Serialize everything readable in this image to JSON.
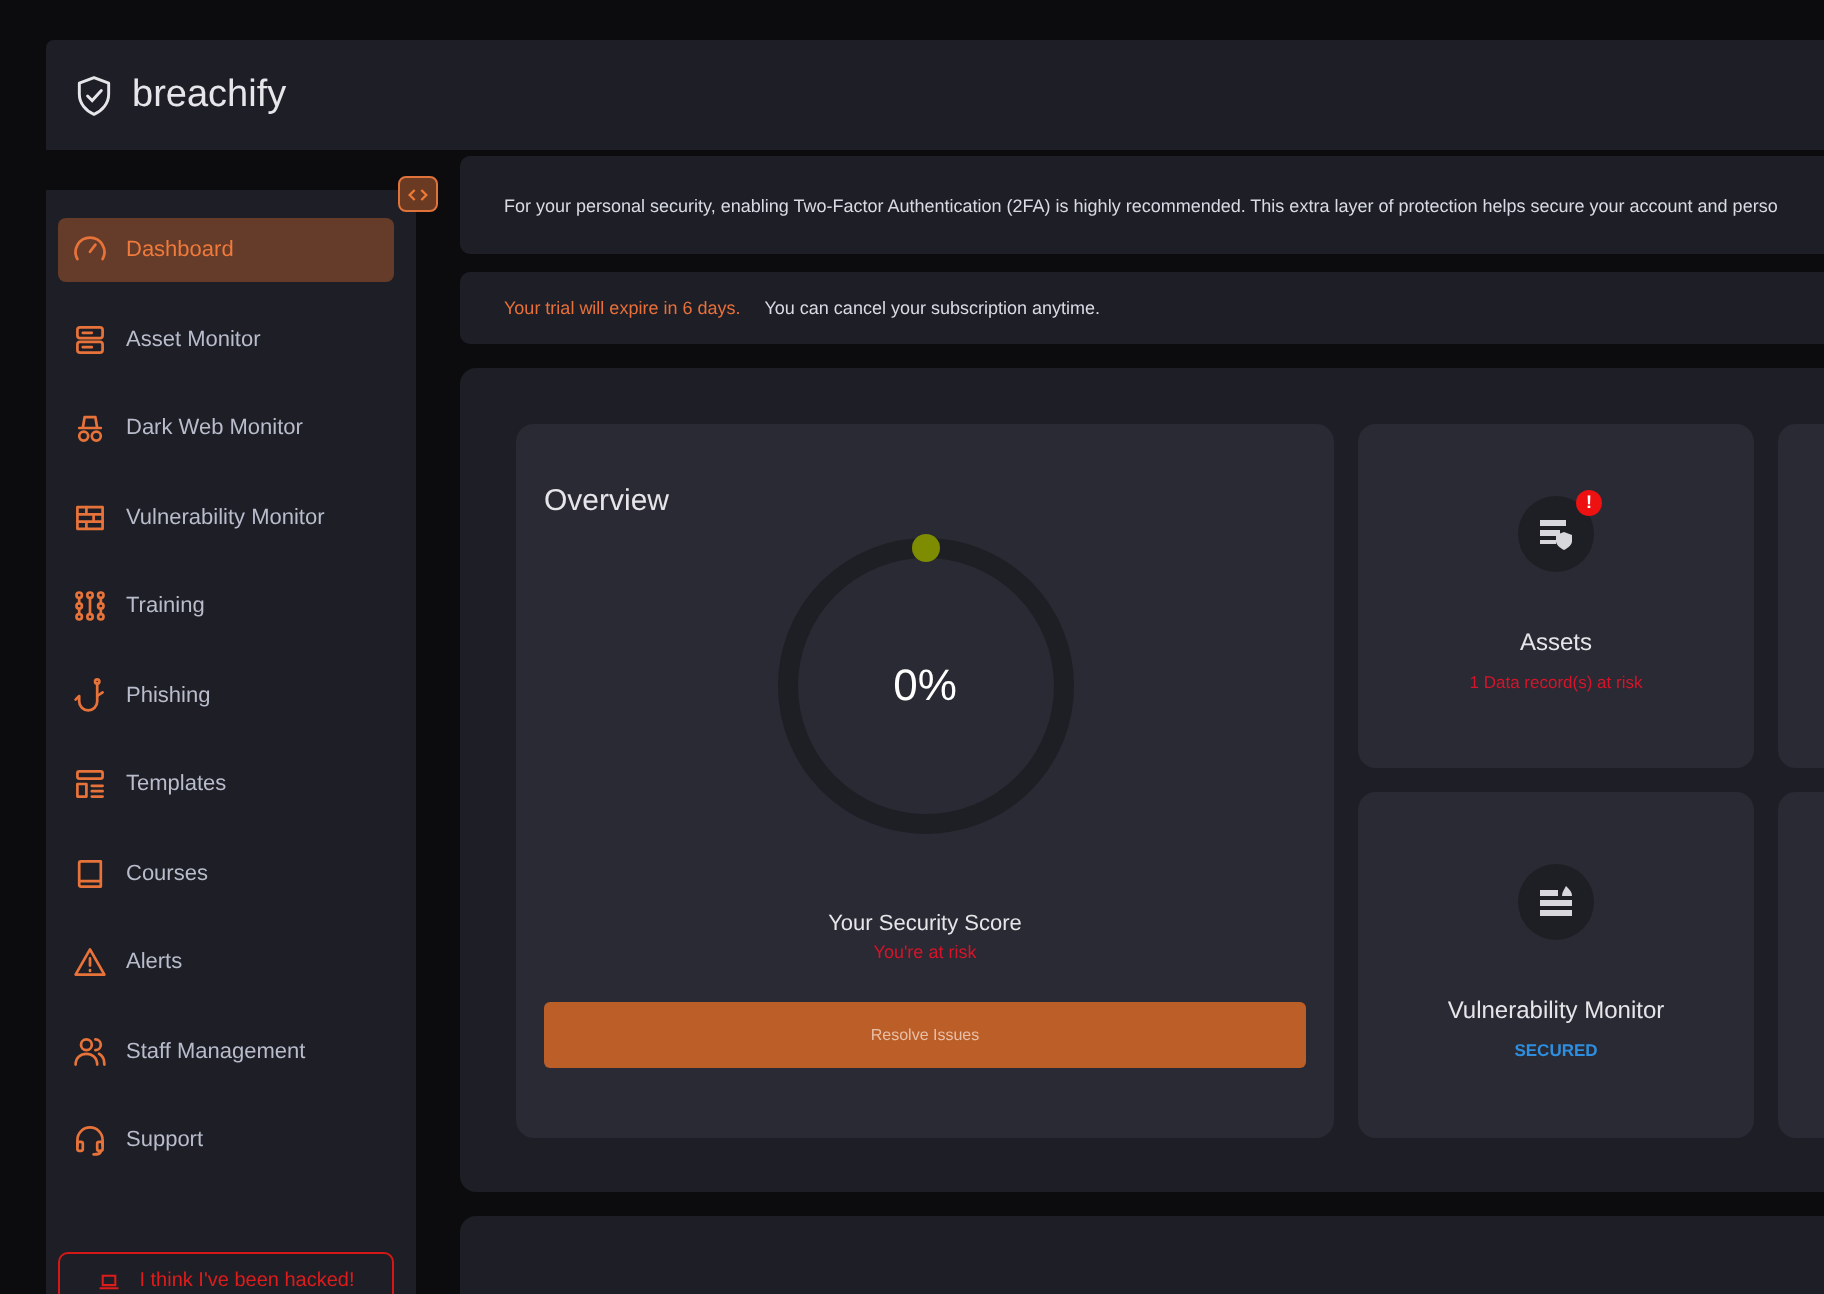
{
  "header": {
    "brand": "breachify"
  },
  "sidebar": {
    "items": [
      {
        "label": "Dashboard",
        "selected": true
      },
      {
        "label": "Asset Monitor",
        "selected": false
      },
      {
        "label": "Dark Web Monitor",
        "selected": false
      },
      {
        "label": "Vulnerability Monitor",
        "selected": false
      },
      {
        "label": "Training",
        "selected": false
      },
      {
        "label": "Phishing",
        "selected": false
      },
      {
        "label": "Templates",
        "selected": false
      },
      {
        "label": "Courses",
        "selected": false
      },
      {
        "label": "Alerts",
        "selected": false
      },
      {
        "label": "Staff Management",
        "selected": false
      },
      {
        "label": "Support",
        "selected": false
      }
    ],
    "hacked_button": "I think I've been hacked!"
  },
  "banners": {
    "twofa": "For your personal security, enabling Two-Factor Authentication (2FA) is highly recommended. This extra layer of protection helps secure your account and perso",
    "trial_warning": "Your trial will expire in 6 days.",
    "trial_note": "You can cancel your subscription anytime."
  },
  "overview": {
    "title": "Overview",
    "score": "0%",
    "level": 0,
    "label": "Your Security Score",
    "status": "You're at risk",
    "button": "Resolve Issues"
  },
  "cards": [
    {
      "title": "Assets",
      "status": "1 Data record(s) at risk",
      "kind": "risk",
      "badge": "!"
    },
    {
      "title": "Vulnerability Monitor",
      "status": "SECURED",
      "kind": "secured"
    }
  ]
}
